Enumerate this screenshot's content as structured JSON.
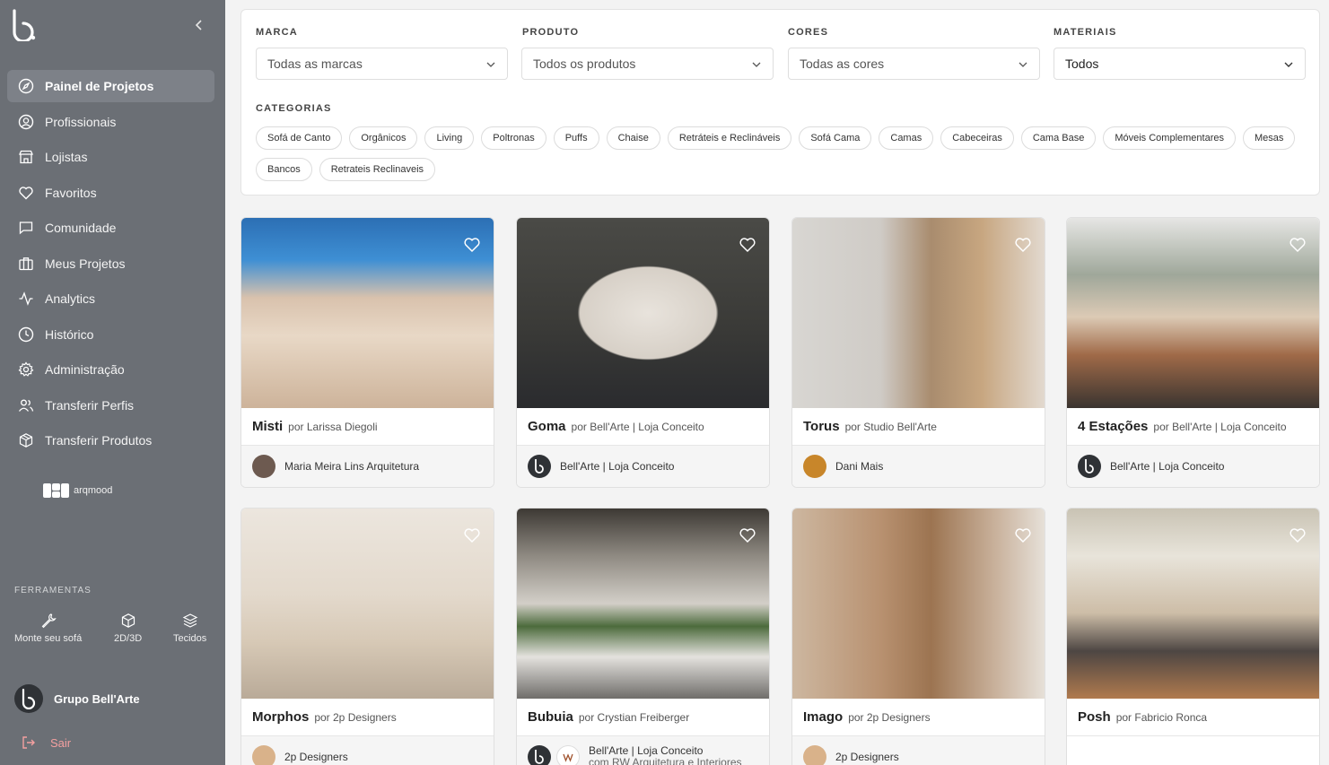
{
  "sidebar": {
    "nav": [
      {
        "label": "Painel de Projetos",
        "icon": "compass-icon",
        "active": true
      },
      {
        "label": "Profissionais",
        "icon": "user-circle-icon"
      },
      {
        "label": "Lojistas",
        "icon": "store-icon"
      },
      {
        "label": "Favoritos",
        "icon": "heart-icon"
      },
      {
        "label": "Comunidade",
        "icon": "chat-icon"
      },
      {
        "label": "Meus Projetos",
        "icon": "briefcase-icon"
      },
      {
        "label": "Analytics",
        "icon": "activity-icon"
      },
      {
        "label": "Histórico",
        "icon": "clock-icon"
      },
      {
        "label": "Administração",
        "icon": "gear-icon"
      },
      {
        "label": "Transferir Perfis",
        "icon": "users-icon"
      },
      {
        "label": "Transferir Produtos",
        "icon": "box-icon"
      }
    ],
    "arqmood": "arqmood",
    "tools_title": "FERRAMENTAS",
    "tools": [
      {
        "label": "Monte seu sofá",
        "icon": "wrench-icon"
      },
      {
        "label": "2D/3D",
        "icon": "cube-icon"
      },
      {
        "label": "Tecidos",
        "icon": "layers-icon"
      }
    ],
    "user_name": "Grupo Bell'Arte",
    "logout": "Sair"
  },
  "filters": {
    "brand": {
      "label": "MARCA",
      "value": "Todas as marcas"
    },
    "product": {
      "label": "PRODUTO",
      "value": "Todos os produtos"
    },
    "colors": {
      "label": "CORES",
      "value": "Todas as cores"
    },
    "materials": {
      "label": "MATERIAIS",
      "value": "Todos"
    },
    "categories_label": "CATEGORIAS",
    "categories": [
      "Sofá de Canto",
      "Orgânicos",
      "Living",
      "Poltronas",
      "Puffs",
      "Chaise",
      "Retráteis e Reclináveis",
      "Sofá Cama",
      "Camas",
      "Cabeceiras",
      "Cama Base",
      "Móveis Complementares",
      "Mesas",
      "Bancos",
      "Retrateis Reclinaveis"
    ]
  },
  "cards": [
    {
      "name": "Misti",
      "by": "por Larissa Diegoli",
      "owner": "Maria Meira Lins Arquitetura"
    },
    {
      "name": "Goma",
      "by": "por Bell'Arte | Loja Conceito",
      "owner": "Bell'Arte | Loja Conceito"
    },
    {
      "name": "Torus",
      "by": "por Studio Bell'Arte",
      "owner": "Dani Mais"
    },
    {
      "name": "4 Estações",
      "by": "por Bell'Arte | Loja Conceito",
      "owner": "Bell'Arte | Loja Conceito"
    },
    {
      "name": "Morphos",
      "by": "por 2p Designers",
      "owner": "2p Designers"
    },
    {
      "name": "Bubuia",
      "by": "por Crystian Freiberger",
      "owner": "Bell'Arte | Loja Conceito",
      "owner_sub": "com RW Arquitetura e Interiores"
    },
    {
      "name": "Imago",
      "by": "por 2p Designers",
      "owner": "2p Designers"
    },
    {
      "name": "Posh",
      "by": "por Fabricio Ronca",
      "owner": ""
    }
  ]
}
